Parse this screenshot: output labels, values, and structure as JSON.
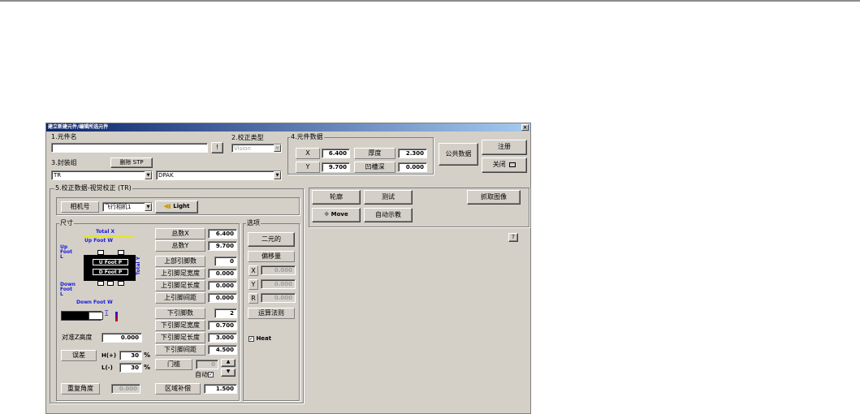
{
  "dialog": {
    "title": "建立新建元件/编辑所选元件",
    "close_icon": "close-icon",
    "section1_label": "1.元件名",
    "component_name": "",
    "name_button": "!",
    "section2_label": "2.校正类型",
    "correction_type": "Vision",
    "section3_label": "3.封装组",
    "delete_button": "删除 STP",
    "package_group": "TR",
    "package_type": "DPAK",
    "section4_label": "4.元件数据",
    "x_label": "X",
    "x_value": "6.400",
    "y_label": "Y",
    "y_value": "9.700",
    "thickness_label": "厚度",
    "thickness_value": "2.300",
    "groove_label": "凹槽深",
    "groove_value": "0.000",
    "public_data_button": "公共数据",
    "register_button": "注册",
    "close_button": "关闭",
    "section5_label": "5.校正数据-视觉校正 (TR)",
    "camera_label": "相机号",
    "camera_value": "飞行相机1",
    "light_button": "Light",
    "contour_button": "轮廓",
    "test_button": "测试",
    "move_button": "Move",
    "auto_teach_button": "自动示教",
    "capture_button": "抓取图像",
    "help_button": "?"
  },
  "dimensions": {
    "group_label": "尺寸",
    "diagram": {
      "total_x": "Total X",
      "up_foot_w": "Up Foot W",
      "up_foot_l": "Up Foot L",
      "u_foot_p": "U Foot P",
      "d_foot_p": "D Foot P",
      "total_y": "Total Y",
      "down_foot_l": "Down Foot L",
      "down_foot_w": "Down Foot W"
    },
    "total_x_label": "总数X",
    "total_x_value": "6.400",
    "total_y_label": "总数Y",
    "total_y_value": "9.700",
    "up_pin_count_label": "上部引脚数",
    "up_pin_count_value": "0",
    "up_pin_width_label": "上引脚足宽度",
    "up_pin_width_value": "0.000",
    "up_pin_length_label": "上引脚足长度",
    "up_pin_length_value": "0.000",
    "up_pin_pitch_label": "上引脚间距",
    "up_pin_pitch_value": "0.000",
    "down_pin_count_label": "下引脚数",
    "down_pin_count_value": "2",
    "down_pin_width_label": "下引脚足宽度",
    "down_pin_width_value": "0.700",
    "down_pin_length_label": "下引脚足长度",
    "down_pin_length_value": "3.000",
    "down_pin_pitch_label": "下引脚间距",
    "down_pin_pitch_value": "4.500",
    "threshold_label": "门槛",
    "threshold_value": "0",
    "auto_label": "自动",
    "z_height_label": "对准Z高度",
    "z_height_value": "0.000",
    "tolerance_label": "误差",
    "tol_plus_label": "H(+)",
    "tol_plus_value": "30",
    "tol_minus_label": "L(-)",
    "tol_minus_value": "30",
    "percent": "%",
    "repeat_angle_label": "重复角度",
    "repeat_angle_value": "0.000",
    "area_comp_label": "区域补偿",
    "area_comp_value": "1.500"
  },
  "options": {
    "group_label": "选项",
    "binary_button": "二元的",
    "offset_button": "偏移量",
    "offset_x_label": "X",
    "offset_x_value": "0.000",
    "offset_y_label": "Y",
    "offset_y_value": "0.000",
    "offset_r_label": "R",
    "offset_r_value": "0.000",
    "algorithm_button": "运算法则",
    "heat_label": "Heat"
  }
}
